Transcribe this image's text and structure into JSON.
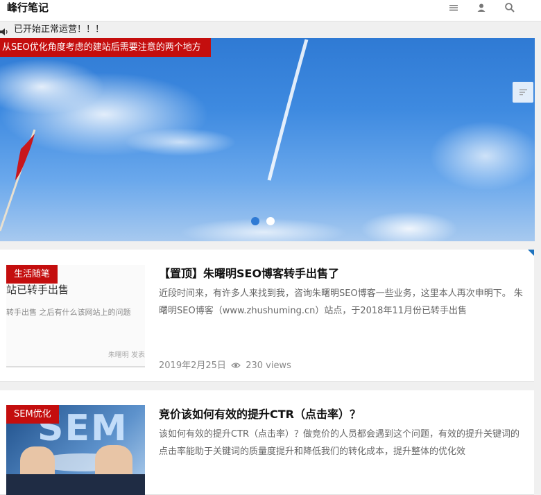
{
  "header": {
    "logo": "峰行笔记",
    "icons": [
      "menu-icon",
      "user-icon",
      "search-icon"
    ]
  },
  "notice": {
    "icon": "speaker-icon",
    "text": "已开始正常运营！！！"
  },
  "slider": {
    "caption": "从SEO优化角度考虑的建站后需要注意的两个地方",
    "menu_icon": "list-icon",
    "dots": [
      {
        "active": true
      },
      {
        "active": false
      }
    ],
    "active_dot_color": "#2f7ad4",
    "inactive_dot_color": "#ffffff"
  },
  "articles": [
    {
      "category": "生活随笔",
      "title": "【置顶】朱曙明SEO博客转手出售了",
      "excerpt": "近段时间来，有许多人来找到我，咨询朱曙明SEO博客一些业务，这里本人再次申明下。 朱曙明SEO博客（www.zhushuming.cn）站点，于2018年11月份已转手出售",
      "thumb_text_1": "站已转手出售",
      "thumb_text_2": "转手出售 之后有什么该网站上的问题",
      "thumb_text_3": "朱曙明 发表",
      "date": "2019年2月25日",
      "views": "230 views"
    },
    {
      "category": "SEM优化",
      "title": "竞价该如何有效的提升CTR（点击率）？",
      "excerpt": "该如何有效的提升CTR（点击率）？做竞价的人员都会遇到这个问题，有效的提升关键词的点击率能助于关键词的质量度提升和降低我们的转化成本，提升整体的优化效",
      "thumb_text_1": "SEM"
    }
  ],
  "colors": {
    "accent": "#c40e0e",
    "corner": "#1e73be"
  }
}
